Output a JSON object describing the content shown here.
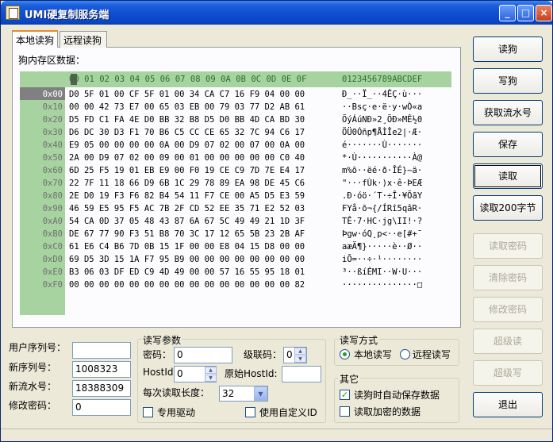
{
  "window": {
    "title": "UMI硬复制服务端",
    "min": "_",
    "max": "□",
    "close": "×"
  },
  "tabs": [
    {
      "label": "本地读狗"
    },
    {
      "label": "远程读狗"
    }
  ],
  "memory": {
    "label": "狗内存区数据：",
    "header_hex": "00 01 02 03 04 05 06 07 08 09 0A 0B 0C 0D 0E 0F",
    "header_ascii": "0123456789ABCDEF",
    "rows": [
      {
        "offset": "0x00",
        "hex": "D0 5F 01 00 CF 5F 01 00 34 CA C7 16 F9 04 00 00",
        "ascii": "Ð_··Ï_··4ÊÇ·ù···"
      },
      {
        "offset": "0x10",
        "hex": "00 00 42 73 E7 00 65 03 EB 00 79 03 77 D2 AB 61",
        "ascii": "··Bsç·e·ë·y·wÒ«a"
      },
      {
        "offset": "0x20",
        "hex": "D5 FD C1 FA 4E D0 BB 32 B8 D5 D0 BB 4D CA BD 30",
        "ascii": "ÕýÁúNÐ»2¸ÕÐ»MÊ½0"
      },
      {
        "offset": "0x30",
        "hex": "D6 DC 30 D3 F1 70 B6 C5 CC CE 65 32 7C 94 C6 17",
        "ascii": "ÖÜ0Óñp¶ÅÌÎe2|·Æ·"
      },
      {
        "offset": "0x40",
        "hex": "E9 05 00 00 00 00 0A 00 D9 07 02 00 07 00 0A 00",
        "ascii": "é·······Ù·······"
      },
      {
        "offset": "0x50",
        "hex": "2A 00 D9 07 02 00 09 00 01 00 00 00 00 00 C0 40",
        "ascii": "*·Ù···········À@"
      },
      {
        "offset": "0x60",
        "hex": "6D 25 F5 19 01 EB E9 00 F0 19 CE C9 7D 7E E4 17",
        "ascii": "m%õ··ëé·ð·ÎÉ}~ä·"
      },
      {
        "offset": "0x70",
        "hex": "22 7F 11 18 66 D9 6B 1C 29 78 89 EA 98 DE 45 C6",
        "ascii": "\"···fÙk·)x·ê·ÞEÆ"
      },
      {
        "offset": "0x80",
        "hex": "2E D0 19 F3 F6 82 B4 54 11 F7 CE 00 A5 D5 E3 59",
        "ascii": ".Ð·óö·´T·÷Î·¥ÕãY"
      },
      {
        "offset": "0x90",
        "hex": "46 59 E5 95 F5 AC 7B 2F CD 52 EE 35 71 E2 52 03",
        "ascii": "FYå·õ¬{/ÍRî5qâR·"
      },
      {
        "offset": "0xA0",
        "hex": "54 CA 0D 37 05 48 43 87 6A 67 5C 49 49 21 1D 3F",
        "ascii": "TÊ·7·HC·jg\\II!·?"
      },
      {
        "offset": "0xB0",
        "hex": "DE 67 77 90 F3 51 B8 70 3C 17 12 65 5B 23 2B AF",
        "ascii": "Þgw·óQ¸p<··e[#+¯"
      },
      {
        "offset": "0xC0",
        "hex": "61 E6 C4 B6 7D 0B 15 1F 00 00 E8 04 15 D8 00 00",
        "ascii": "aæÄ¶}·····è··Ø··"
      },
      {
        "offset": "0xD0",
        "hex": "69 D5 3D 15 1A F7 95 B9 00 00 00 00 00 00 00 00",
        "ascii": "iÕ=··÷·¹········"
      },
      {
        "offset": "0xE0",
        "hex": "B3 06 03 DF ED C9 4D 49 00 00 57 16 55 95 18 01",
        "ascii": "³··ßíÉMI··W·U···"
      },
      {
        "offset": "0xF0",
        "hex": "00 00 00 00 00 00 00 00 00 00 00 00 00 00 00 82",
        "ascii": "···············□"
      }
    ]
  },
  "side_buttons": [
    {
      "label": "读狗",
      "enabled": true
    },
    {
      "label": "写狗",
      "enabled": true
    },
    {
      "label": "获取流水号",
      "enabled": true
    },
    {
      "label": "保存",
      "enabled": true
    },
    {
      "label": "读取",
      "enabled": true
    },
    {
      "label": "读取200字节",
      "enabled": true
    },
    {
      "label": "读取密码",
      "enabled": false
    },
    {
      "label": "清除密码",
      "enabled": false
    },
    {
      "label": "修改密码",
      "enabled": false
    },
    {
      "label": "超级读",
      "enabled": false
    },
    {
      "label": "超级写",
      "enabled": false
    },
    {
      "label": "退出",
      "enabled": true
    }
  ],
  "left_form": {
    "user_serial_label": "用户序列号：",
    "user_serial_value": "",
    "new_serial_label": "新序列号：",
    "new_serial_value": "1008323",
    "new_flow_label": "新流水号：",
    "new_flow_value": "18388309",
    "change_pwd_label": "修改密码：",
    "change_pwd_value": "0"
  },
  "rw_params": {
    "title": "读写参数",
    "password_label": "密码：",
    "password_value": "0",
    "level_label": "级联码：",
    "level_value": "0",
    "hostid_label": "HostId:",
    "hostid_value": "0",
    "orig_hostid_label": "原始HostId:",
    "orig_hostid_value": "",
    "read_len_label": "每次读取长度：",
    "read_len_value": "32",
    "dedicated_driver_label": "专用驱动",
    "dedicated_driver_checked": false,
    "custom_id_label": "使用自定义ID",
    "custom_id_checked": false
  },
  "rw_mode": {
    "title": "读写方式",
    "local_label": "本地读写",
    "remote_label": "远程读写",
    "selected": "local"
  },
  "other": {
    "title": "其它",
    "autosave_label": "读狗时自动保存数据",
    "autosave_checked": true,
    "encrypted_label": "读取加密的数据",
    "encrypted_checked": false
  },
  "icons": {
    "spin_up": "▲",
    "spin_down": "▼",
    "combo_arrow": "▼",
    "check": "✓"
  },
  "colors": {
    "title_bar": "#0b47c6",
    "hex_header": "#a7d3a0",
    "tab_accent": "#e68b2c"
  }
}
